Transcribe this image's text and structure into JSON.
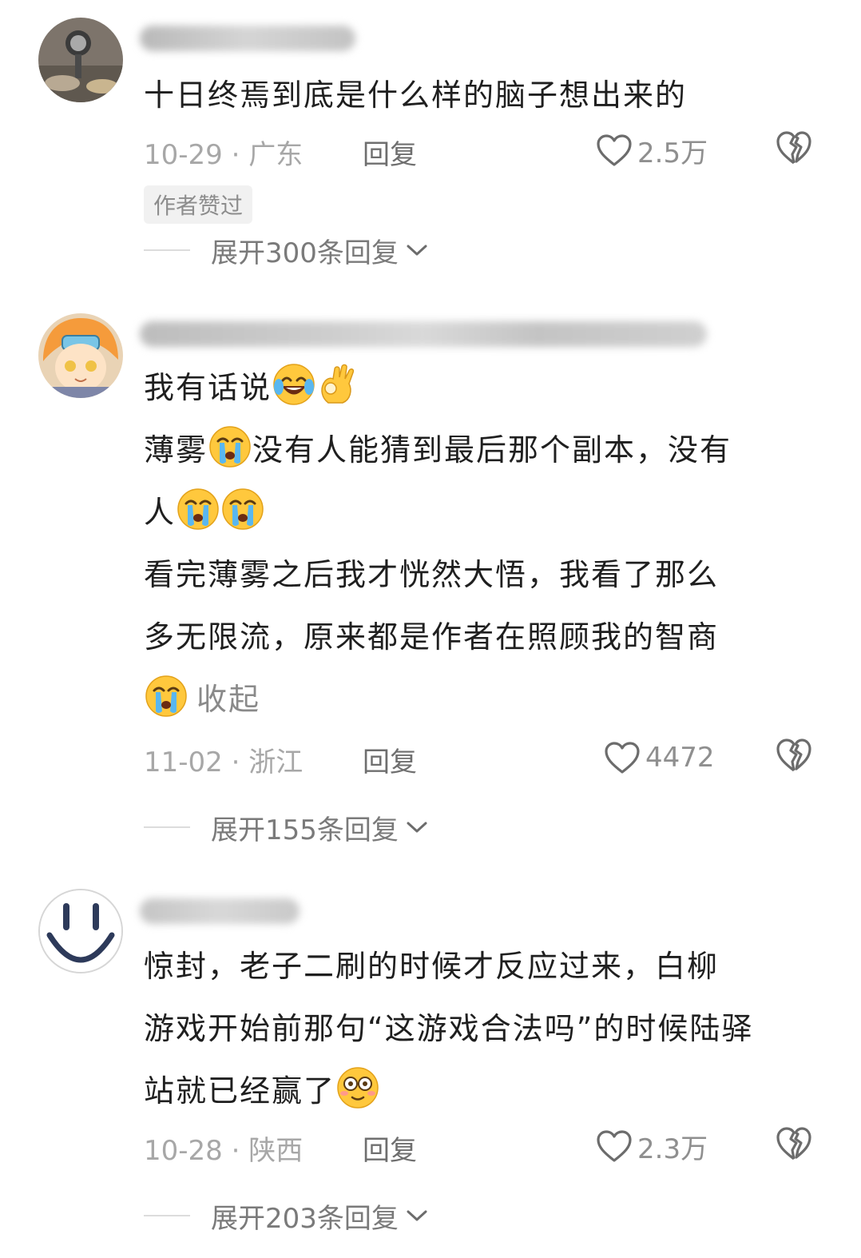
{
  "comments": [
    {
      "text_lines": [
        "十日终焉到底是什么样的脑子想出来的"
      ],
      "date_location": "10-29 · 广东",
      "reply_label": "回复",
      "like_count": "2.5万",
      "badge": "作者赞过",
      "expand_label": "展开300条回复",
      "avatar_icon": "photo-avatar",
      "colors": {
        "avatar_bg": "#8a7f73"
      }
    },
    {
      "text_lines": [
        {
          "text": "我有话说",
          "emojis_after": [
            "laugh-cry-emoji",
            "ok-hand-emoji"
          ]
        },
        {
          "prefix": "薄雾",
          "emoji_mid": "crying-emoji",
          "text": "没有人能猜到最后那个副本，没有"
        },
        {
          "text": "人",
          "emojis_after": [
            "crying-emoji",
            "crying-emoji"
          ]
        },
        {
          "text": "看完薄雾之后我才恍然大悟，我看了那么"
        },
        {
          "text": "多无限流，原来都是作者在照顾我的智商"
        }
      ],
      "collapse_label": "收起",
      "date_location": "11-02 · 浙江",
      "reply_label": "回复",
      "like_count": "4472",
      "expand_label": "展开155条回复",
      "avatar_icon": "anime-avatar",
      "colors": {
        "avatar_bg": "#f4a24a"
      }
    },
    {
      "text_lines": [
        "惊封，老子二刷的时候才反应过来，白柳",
        "游戏开始前那句“这游戏合法吗”的时候陆驿",
        "站就已经赢了"
      ],
      "date_location": "10-28 · 陕西",
      "reply_label": "回复",
      "like_count": "2.3万",
      "expand_label": "展开203条回复",
      "avatar_icon": "smiley-avatar",
      "end_emoji": "dazed-emoji"
    }
  ],
  "icons": {
    "like": "heart-outline-icon",
    "dislike": "broken-heart-icon",
    "expand": "chevron-down-icon"
  },
  "colors": {
    "text": "#1f1f1f",
    "meta": "#a7a7a7",
    "reply": "#6f6f6f",
    "emoji_yellow": "#ffc83d"
  }
}
